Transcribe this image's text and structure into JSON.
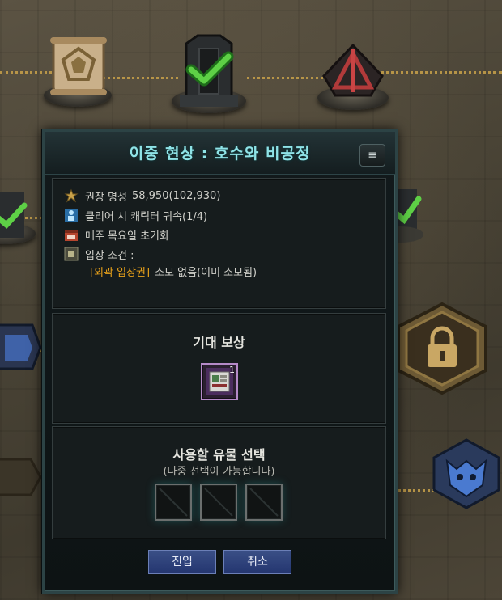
{
  "dialog": {
    "title": "이중 현상 : 호수와 비공정",
    "menu_icon": "≡",
    "info": {
      "reputation_label": "권장 명성",
      "reputation_value": "58,950",
      "reputation_paren": "(102,930)",
      "bind_text": "클리어 시 캐릭터 귀속(1/4)",
      "reset_text": "매주 목요일 초기화",
      "entry_label": "입장 조건 :",
      "entry_item": "[외곽 입장권]",
      "entry_detail": "소모 없음(이미 소모됨)"
    },
    "reward": {
      "title": "기대 보상",
      "item_count": "1",
      "item_icon": "ticket-card-icon"
    },
    "relic": {
      "title": "사용할 유물 선택",
      "subtitle": "(다중 선택이 가능합니다)",
      "slots": [
        "empty",
        "empty",
        "empty"
      ]
    },
    "buttons": {
      "enter": "진입",
      "cancel": "취소"
    }
  },
  "colors": {
    "title": "#8fe3e7",
    "highlight": "#e8a11a",
    "button": "#2e438a",
    "map_path": "#c9a24a"
  }
}
